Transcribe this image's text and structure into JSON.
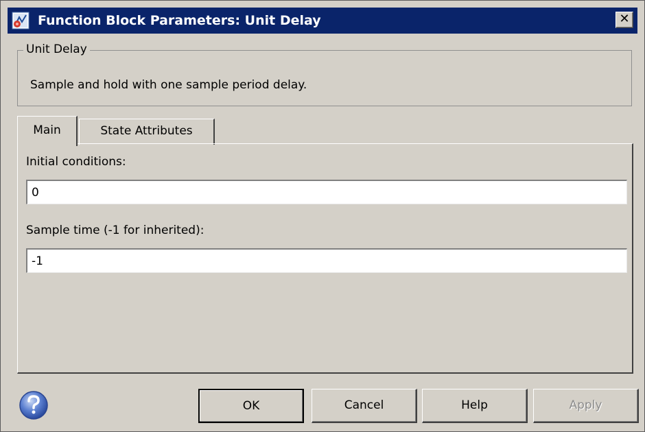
{
  "window": {
    "title": "Function Block Parameters: Unit Delay",
    "close_glyph": "✕",
    "title_bar_color": "#0a246a"
  },
  "block": {
    "name": "Unit Delay",
    "description": "Sample and hold with one sample period delay."
  },
  "tabs": [
    {
      "label": "Main",
      "active": true
    },
    {
      "label": "State Attributes",
      "active": false
    }
  ],
  "main": {
    "initial_conditions_label": "Initial conditions:",
    "initial_conditions_value": "0",
    "sample_time_label": "Sample time (-1 for inherited):",
    "sample_time_value": "-1"
  },
  "buttons": {
    "ok": "OK",
    "cancel": "Cancel",
    "help": "Help",
    "apply": "Apply",
    "apply_enabled": false
  },
  "icons": {
    "app": "simulink-block-icon",
    "help": "help-question-icon",
    "close": "close-icon"
  }
}
